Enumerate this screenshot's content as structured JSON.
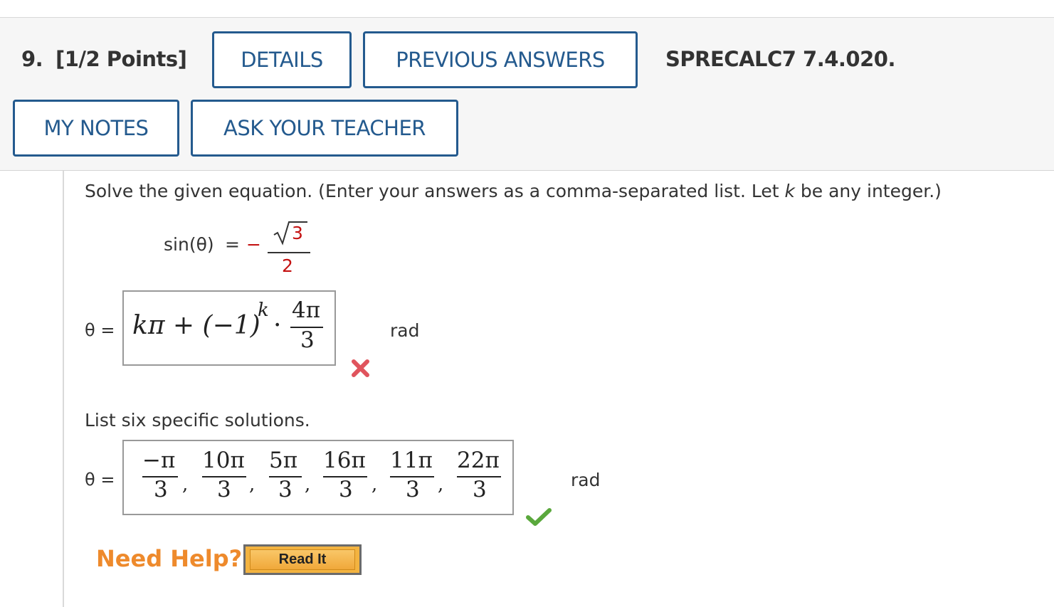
{
  "question": {
    "number": "9.",
    "points": "[1/2 Points]",
    "code": "SPRECALC7 7.4.020."
  },
  "buttons": {
    "details": "DETAILS",
    "previous_answers": "PREVIOUS ANSWERS",
    "my_notes": "MY NOTES",
    "ask_teacher": "ASK YOUR TEACHER"
  },
  "prompt": {
    "before_k": "Solve the given equation. (Enter your answers as a comma-separated list. Let ",
    "k": "k",
    "after_k": " be any integer.)"
  },
  "equation": {
    "lhs": "sin(θ)",
    "equals": "=",
    "minus": "−",
    "numerator": "3",
    "denominator": "2"
  },
  "answer1": {
    "theta_label": "θ =",
    "expression": "kπ + (−1)^k · 4π/3",
    "term1": "kπ + (−1)",
    "exponent": "k",
    "dot": "·",
    "frac_num": "4π",
    "frac_den": "3",
    "unit": "rad",
    "status": "incorrect",
    "status_color": "#e0545d"
  },
  "list_prompt": "List six specific solutions.",
  "answer2": {
    "theta_label": "θ =",
    "fractions": [
      {
        "num": "−π",
        "den": "3"
      },
      {
        "num": "10π",
        "den": "3"
      },
      {
        "num": "5π",
        "den": "3"
      },
      {
        "num": "16π",
        "den": "3"
      },
      {
        "num": "11π",
        "den": "3"
      },
      {
        "num": "22π",
        "den": "3"
      }
    ],
    "separator": ",",
    "unit": "rad",
    "status": "correct",
    "status_color": "#5aa83c"
  },
  "help": {
    "label": "Need Help?",
    "read_it": "Read It"
  },
  "colors": {
    "accent": "#245a8e",
    "help_orange": "#ee8a2c",
    "button_yellow": "#f3b340",
    "math_red": "#c41212"
  }
}
